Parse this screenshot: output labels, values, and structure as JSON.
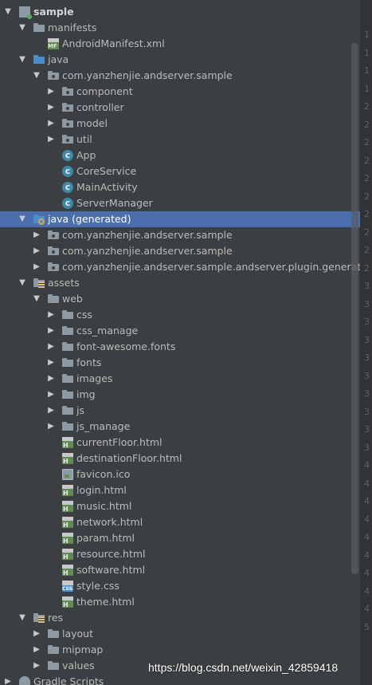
{
  "project": {
    "root": "sample",
    "top_partial": "",
    "bottom_item": "Gradle Scripts"
  },
  "tree": [
    {
      "label": "manifests",
      "icon": "folder-icon",
      "expanded": true
    },
    {
      "label": "AndroidManifest.xml",
      "icon": "manifest-file-icon"
    },
    {
      "label": "java",
      "icon": "java-source-folder-icon",
      "expanded": true
    },
    {
      "label": "com.yanzhenjie.andserver.sample",
      "icon": "package-icon",
      "expanded": true
    },
    {
      "label": "component",
      "icon": "package-icon",
      "expanded": false
    },
    {
      "label": "controller",
      "icon": "package-icon",
      "expanded": false
    },
    {
      "label": "model",
      "icon": "package-icon",
      "expanded": false
    },
    {
      "label": "util",
      "icon": "package-icon",
      "expanded": false
    },
    {
      "label": "App",
      "icon": "class-icon"
    },
    {
      "label": "CoreService",
      "icon": "class-icon"
    },
    {
      "label": "MainActivity",
      "icon": "class-icon"
    },
    {
      "label": "ServerManager",
      "icon": "class-icon"
    },
    {
      "label": "java (generated)",
      "icon": "generated-folder-icon",
      "expanded": true,
      "selected": true
    },
    {
      "label": "com.yanzhenjie.andserver.sample",
      "icon": "package-icon",
      "expanded": false
    },
    {
      "label": "com.yanzhenjie.andserver.sample",
      "icon": "package-icon",
      "expanded": false
    },
    {
      "label": "com.yanzhenjie.andserver.sample.andserver.plugin.generator",
      "icon": "package-icon",
      "expanded": false
    },
    {
      "label": "assets",
      "icon": "assets-folder-icon",
      "expanded": true
    },
    {
      "label": "web",
      "icon": "folder-icon",
      "expanded": true
    },
    {
      "label": "css",
      "icon": "folder-icon",
      "expanded": false
    },
    {
      "label": "css_manage",
      "icon": "folder-icon",
      "expanded": false
    },
    {
      "label": "font-awesome.fonts",
      "icon": "folder-icon",
      "expanded": false
    },
    {
      "label": "fonts",
      "icon": "folder-icon",
      "expanded": false
    },
    {
      "label": "images",
      "icon": "folder-icon",
      "expanded": false
    },
    {
      "label": "img",
      "icon": "folder-icon",
      "expanded": false
    },
    {
      "label": "js",
      "icon": "folder-icon",
      "expanded": false
    },
    {
      "label": "js_manage",
      "icon": "folder-icon",
      "expanded": false
    },
    {
      "label": "currentFloor.html",
      "icon": "html-file-icon"
    },
    {
      "label": "destinationFloor.html",
      "icon": "html-file-icon"
    },
    {
      "label": "favicon.ico",
      "icon": "ico-file-icon"
    },
    {
      "label": "login.html",
      "icon": "html-file-icon"
    },
    {
      "label": "music.html",
      "icon": "html-file-icon"
    },
    {
      "label": "network.html",
      "icon": "html-file-icon"
    },
    {
      "label": "param.html",
      "icon": "html-file-icon"
    },
    {
      "label": "resource.html",
      "icon": "html-file-icon"
    },
    {
      "label": "software.html",
      "icon": "html-file-icon"
    },
    {
      "label": "style.css",
      "icon": "css-file-icon"
    },
    {
      "label": "theme.html",
      "icon": "html-file-icon"
    },
    {
      "label": "res",
      "icon": "res-folder-icon",
      "expanded": true
    },
    {
      "label": "layout",
      "icon": "folder-icon",
      "expanded": false
    },
    {
      "label": "mipmap",
      "icon": "folder-icon",
      "expanded": false
    },
    {
      "label": "values",
      "icon": "folder-icon",
      "expanded": false
    }
  ],
  "gutter_numbers": [
    "1",
    "1",
    "1",
    "1",
    "2",
    "2",
    "2",
    "2",
    "2",
    "2",
    "2",
    "2",
    "2",
    "2",
    "3",
    "3",
    "3",
    "3",
    "3",
    "3",
    "3",
    "3",
    "3",
    "3",
    "4",
    "4",
    "4",
    "4",
    "4",
    "4",
    "4",
    "4",
    "4",
    "5"
  ],
  "watermark": "https://blog.csdn.net/weixin_42859418",
  "colors": {
    "background": "#3c3f41",
    "selection": "#4b6eaf",
    "text": "#bbbbbb",
    "gutter": "#313335"
  }
}
